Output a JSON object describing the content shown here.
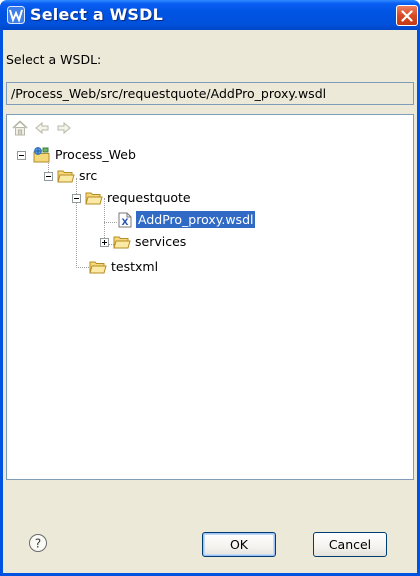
{
  "window": {
    "title": "Select a WSDL",
    "title_bar_color": "#0054e3",
    "close_button_color": "#d84a23"
  },
  "dialog": {
    "prompt_label": "Select a WSDL:",
    "selected_path": "/Process_Web/src/requestquote/AddPro_proxy.wsdl"
  },
  "toolbar": {
    "icons": [
      "home-icon",
      "back-arrow-icon",
      "forward-arrow-icon"
    ]
  },
  "tree": {
    "project": "Process_Web",
    "src": "src",
    "requestquote": "requestquote",
    "wsdl_file": "AddPro_proxy.wsdl",
    "services": "services",
    "testxml": "testxml",
    "selection_color": "#316ac5"
  },
  "buttons": {
    "ok": "OK",
    "cancel": "Cancel"
  }
}
